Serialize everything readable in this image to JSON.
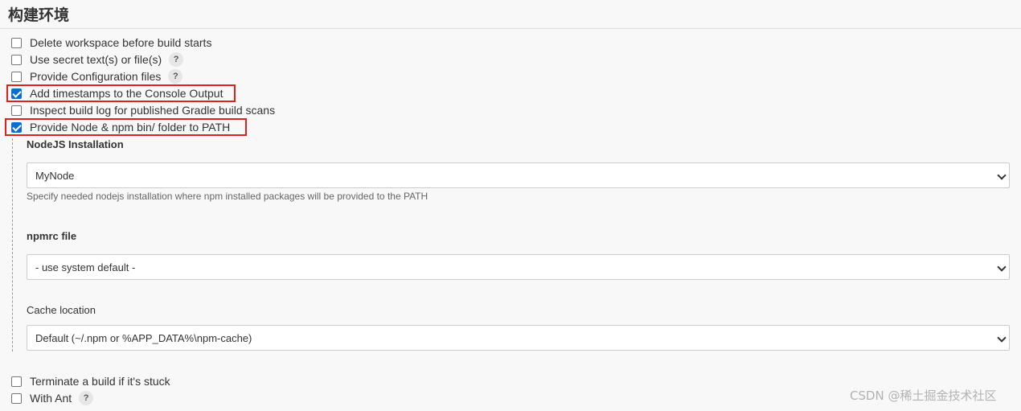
{
  "section": {
    "title": "构建环境"
  },
  "options": [
    {
      "label": "Delete workspace before build starts",
      "checked": false,
      "help": false
    },
    {
      "label": "Use secret text(s) or file(s)",
      "checked": false,
      "help": true
    },
    {
      "label": "Provide Configuration files",
      "checked": false,
      "help": true
    },
    {
      "label": "Add timestamps to the Console Output",
      "checked": true,
      "help": false
    },
    {
      "label": "Inspect build log for published Gradle build scans",
      "checked": false,
      "help": false
    },
    {
      "label": "Provide Node & npm bin/ folder to PATH",
      "checked": true,
      "help": false
    }
  ],
  "help_icon": {
    "glyph": "?",
    "icon": "question-mark-icon"
  },
  "nodejs": {
    "installation_label": "NodeJS Installation",
    "installation_value": "MyNode",
    "installation_help": "Specify needed nodejs installation where npm installed packages will be provided to the PATH",
    "npmrc_label": "npmrc file",
    "npmrc_value": "- use system default -",
    "cache_label": "Cache location",
    "cache_value": "Default (~/.npm or %APP_DATA%\\npm-cache)"
  },
  "bottom_options": [
    {
      "label": "Terminate a build if it's stuck",
      "checked": false,
      "help": false
    },
    {
      "label": "With Ant",
      "checked": false,
      "help": true
    }
  ],
  "watermark": "CSDN @稀土掘金技术社区",
  "colors": {
    "highlight": "#e0201b",
    "checkbox_checked": "#0a6ed1"
  }
}
